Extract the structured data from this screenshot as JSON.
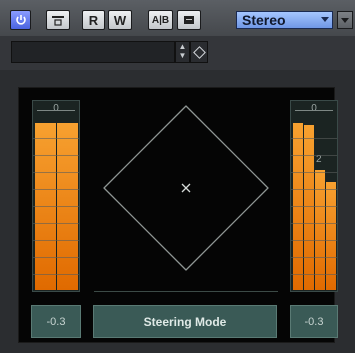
{
  "toolbar": {
    "power_icon": "power-icon",
    "window_icon": "window-icon",
    "read_label": "R",
    "write_label": "W",
    "ab_label": "A|B",
    "menu_icon": "menu-icon",
    "output_select": "Stereo",
    "expand_icon": "chevron-down-icon"
  },
  "preset": {
    "field_value": "",
    "stepper_icon": "stepper-icon",
    "preset_icon": "diamond-icon"
  },
  "meters": {
    "left": {
      "zero_label": "0",
      "levels": [
        0.88,
        0.88
      ]
    },
    "right": {
      "zero_label": "0",
      "levels": [
        0.88,
        0.87,
        0.63,
        0.57
      ],
      "scale_labels": [
        "2"
      ]
    }
  },
  "steering": {
    "position": "center",
    "icon": "crosshair-icon"
  },
  "readouts": {
    "left_value": "-0.3",
    "right_value": "-0.3"
  },
  "mode_button": {
    "label": "Steering Mode"
  },
  "colors": {
    "accent": "#6f97e6",
    "meter": "#f08a1e",
    "panel": "#3a5a56"
  }
}
